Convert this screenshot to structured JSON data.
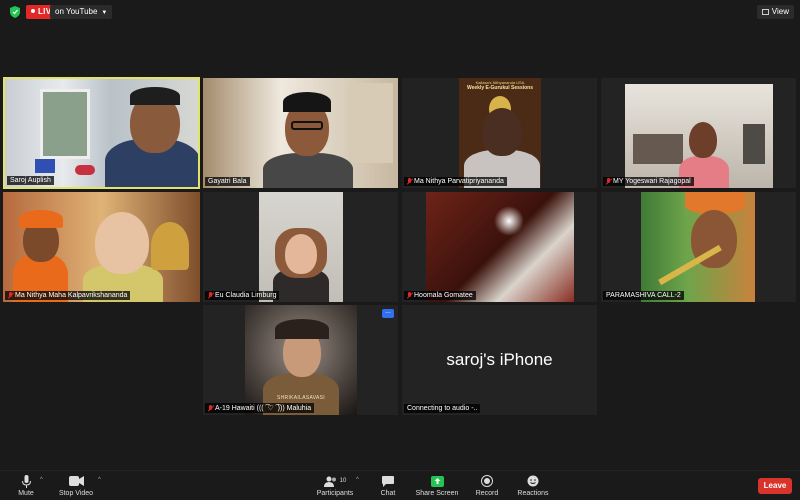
{
  "topbar": {
    "live_label": "LIVE",
    "stream_target": "on YouTube",
    "view_label": "View"
  },
  "participants": [
    {
      "name": "Saroj Auplish",
      "muted": false
    },
    {
      "name": "Gayatri Bala",
      "muted": false
    },
    {
      "name": "Ma Nithya Parvatipriyananda",
      "muted": true
    },
    {
      "name": "MY Yogeswari Rajagopal",
      "muted": true
    },
    {
      "name": "Ma Nithya Maha Kalpavrikshananda",
      "muted": true
    },
    {
      "name": "Eu Claudia Limburg",
      "muted": true
    },
    {
      "name": "Hoomala Gomatee",
      "muted": true
    },
    {
      "name": "PARAMASHIVA CALL-2",
      "muted": false
    },
    {
      "name": "A-19 Hawaiti ((( ͡ ♡ ͡ ))) Maluhia",
      "muted": true
    },
    {
      "name": "Connecting to audio -..",
      "muted": false
    }
  ],
  "tile_texts": {
    "poster_line1": "Kailasa's Nithyananda USA",
    "poster_line2": "Weekly E-Gurukul Sessions",
    "badge_text": "SHRIKAILASAVASI",
    "phone_display": "saroj's iPhone",
    "more_dots": "..."
  },
  "toolbar": {
    "mute": "Mute",
    "stop_video": "Stop Video",
    "participants": "Participants",
    "participants_count": "10",
    "chat": "Chat",
    "share_screen": "Share Screen",
    "record": "Record",
    "reactions": "Reactions",
    "leave": "Leave"
  },
  "colors": {
    "live_red": "#e02828",
    "active_border": "#e3e36a",
    "share_green": "#23c552",
    "leave_red": "#d9342b"
  }
}
